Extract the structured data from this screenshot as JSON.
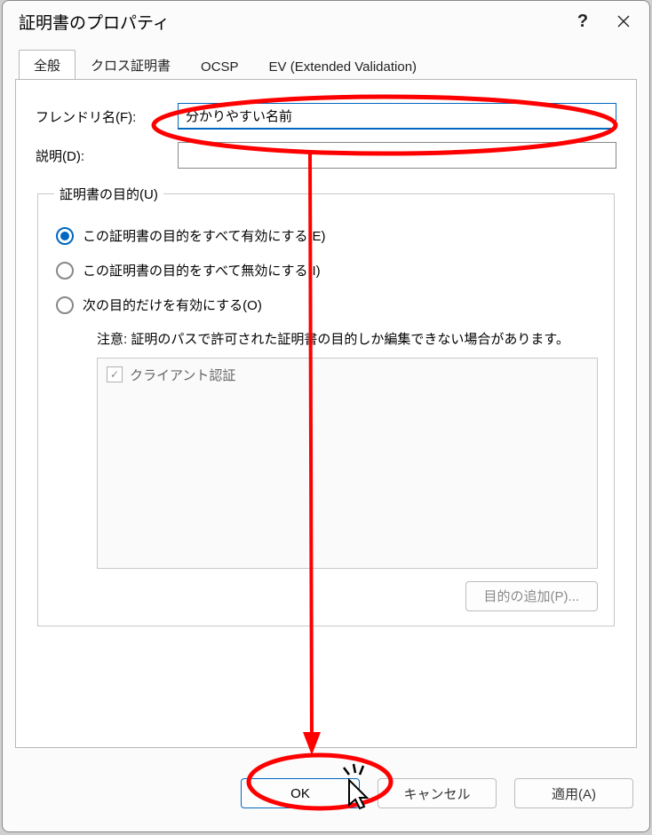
{
  "window": {
    "title": "証明書のプロパティ"
  },
  "tabs": {
    "general": "全般",
    "cross": "クロス証明書",
    "ocsp": "OCSP",
    "ev": "EV (Extended Validation)"
  },
  "fields": {
    "friendlyLabel": "フレンドリ名(F):",
    "friendlyValue": "分かりやすい名前",
    "descLabel": "説明(D):",
    "descValue": ""
  },
  "purpose": {
    "legend": "証明書の目的(U)",
    "optAll": "この証明書の目的をすべて有効にする(E)",
    "optNone": "この証明書の目的をすべて無効にする(I)",
    "optOnly": "次の目的だけを有効にする(O)",
    "note": "注意: 証明のパスで許可された証明書の目的しか編集できない場合があります。",
    "item1": "クライアント認証",
    "addBtn": "目的の追加(P)..."
  },
  "buttons": {
    "ok": "OK",
    "cancel": "キャンセル",
    "apply": "適用(A)"
  },
  "annotation": {
    "color": "#ff0000"
  }
}
